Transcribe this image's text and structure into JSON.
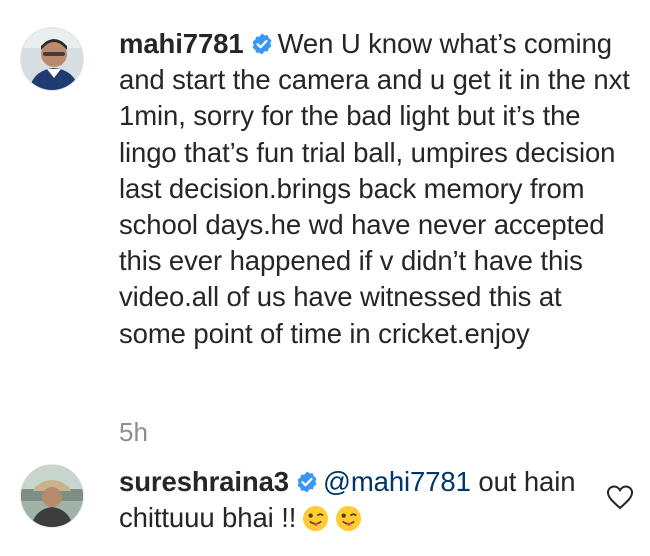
{
  "comments": [
    {
      "username": "mahi7781",
      "text": "Wen U know what’s coming and start the camera and u get it in the nxt 1min, sorry for the bad light but it’s the lingo that’s fun trial ball, umpires decision last decision.brings back memory from school days.he wd have never accepted this ever happened if v didn’t have this video.all of us have witnessed this at some point of time in cricket.enjoy",
      "timestamp": "5h"
    },
    {
      "username": "sureshraina3",
      "mention": "@mahi7781",
      "text": "out hain chittuuu bhai !!",
      "emojis": [
        "winking-face-with-tongue",
        "winking-face-with-tongue"
      ]
    }
  ],
  "colors": {
    "verified_badge": "#3897f0",
    "mention": "#003569",
    "timestamp": "#8e8e8e"
  }
}
